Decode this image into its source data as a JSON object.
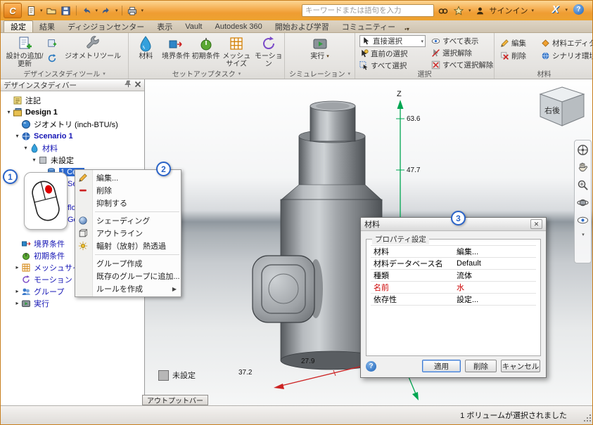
{
  "titlebar": {
    "search_placeholder": "キーワードまたは語句を入力",
    "signin_label": "サインイン"
  },
  "menubar": {
    "tabs": [
      {
        "label": "設定"
      },
      {
        "label": "結果"
      },
      {
        "label": "ディシジョンセンター"
      },
      {
        "label": "表示"
      },
      {
        "label": "Vault"
      },
      {
        "label": "Autodesk 360"
      },
      {
        "label": "開始および学習"
      },
      {
        "label": "コミュニティー"
      }
    ]
  },
  "ribbon": {
    "group_labels": [
      "デザインスタディツール",
      "セットアップタスク",
      "シミュレーション",
      "選択",
      "材料"
    ],
    "buttons": {
      "add_update": "設計の追加/更新",
      "geometry_tools": "ジオメトリツール",
      "material": "材料",
      "boundary": "境界条件",
      "initial": "初期条件",
      "mesh_size": "メッシュサイズ",
      "motion": "モーション",
      "run": "実行",
      "direct_select": "直接選択",
      "previous_select": "直前の選択",
      "select_all": "すべて選択",
      "show_all": "すべて表示",
      "deselect": "選択解除",
      "deselect_all": "すべて選択解除",
      "edit": "編集",
      "delete": "削除",
      "material_editor": "材料エディタ",
      "scenario_env": "シナリオ環境"
    }
  },
  "design_study_bar": {
    "title": "デザインスタディバー",
    "items": [
      {
        "label": "注記"
      },
      {
        "label": "Design 1"
      },
      {
        "label": "ジオメトリ (inch-BTU/s)"
      },
      {
        "label": "Scenario 1"
      },
      {
        "label": "材料"
      },
      {
        "label": "未設定"
      },
      {
        "label": "1 Ce..."
      },
      {
        "label": "Se..."
      },
      {
        "label": "flo..."
      },
      {
        "label": "Ge..."
      },
      {
        "label": "境界条件"
      },
      {
        "label": "初期条件"
      },
      {
        "label": "メッシュサイズ"
      },
      {
        "label": "モーション"
      },
      {
        "label": "グループ"
      },
      {
        "label": "実行"
      }
    ]
  },
  "context_menu": {
    "items": [
      {
        "label": "編集..."
      },
      {
        "label": "削除"
      },
      {
        "label": "抑制する"
      },
      {
        "label": "シェーディング"
      },
      {
        "label": "アウトライン"
      },
      {
        "label": "輻射（放射）熱透過"
      },
      {
        "label": "グループ作成"
      },
      {
        "label": "既存のグループに追加..."
      },
      {
        "label": "ルールを作成"
      }
    ]
  },
  "material_dialog": {
    "title": "材料",
    "group_title": "プロパティ設定",
    "rows": [
      {
        "label": "材料",
        "value": "編集..."
      },
      {
        "label": "材料データベース名",
        "value": "Default"
      },
      {
        "label": "種類",
        "value": "流体"
      },
      {
        "label": "名前",
        "value": "水"
      },
      {
        "label": "依存性",
        "value": "設定..."
      }
    ],
    "buttons": {
      "apply": "適用",
      "delete": "削除",
      "cancel": "キャンセル"
    }
  },
  "viewport": {
    "legend": "未設定",
    "viewcube_label": "右後",
    "axes": {
      "z_label": "Z",
      "z_ticks": [
        "63.6",
        "47.7"
      ],
      "x_ticks": [
        "27.9",
        "37.2"
      ]
    }
  },
  "output_bar": {
    "label": "アウトプットバー"
  },
  "status_bar": {
    "message": "1 ボリュームが選択されました"
  },
  "callouts": [
    {
      "n": "1"
    },
    {
      "n": "2"
    },
    {
      "n": "3"
    }
  ],
  "colors": {
    "titlebar_orange": "#f0a43c",
    "selection_blue": "#2f6bd0",
    "tree_link_blue": "#1515b5",
    "alert_red": "#cc0000",
    "axis_green": "#00a651",
    "axis_red": "#cc2222",
    "legend_gray": "#b7b7b7"
  }
}
